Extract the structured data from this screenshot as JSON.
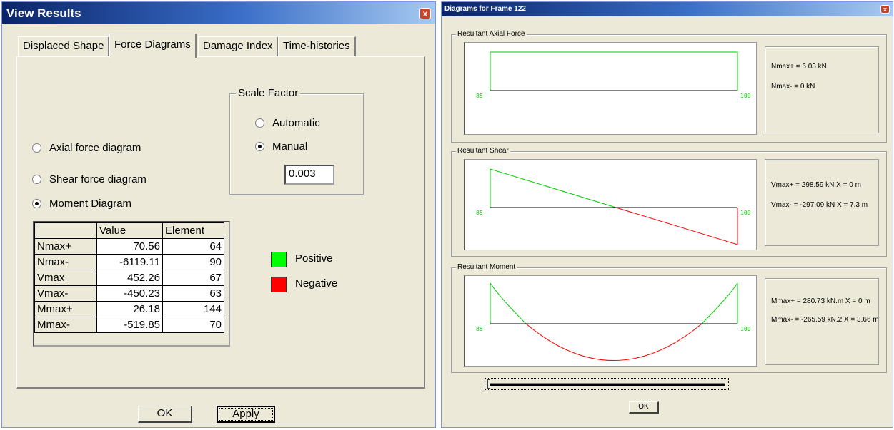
{
  "left_window": {
    "title": "View Results",
    "close_label": "x",
    "tabs": [
      {
        "label": "Displaced Shape"
      },
      {
        "label": "Force Diagrams"
      },
      {
        "label": "Damage Index"
      },
      {
        "label": "Time-histories"
      }
    ],
    "scale_factor": {
      "legend": "Scale Factor",
      "automatic_label": "Automatic",
      "manual_label": "Manual",
      "selected": "Manual",
      "value": "0.003"
    },
    "diagram_options": [
      {
        "label": "Axial force diagram",
        "checked": false
      },
      {
        "label": "Shear force diagram",
        "checked": false
      },
      {
        "label": "Moment Diagram",
        "checked": true
      }
    ],
    "results_table": {
      "headers": [
        "",
        "Value",
        "Element"
      ],
      "rows": [
        {
          "name": "Nmax+",
          "value": "70.56",
          "element": "64"
        },
        {
          "name": "Nmax-",
          "value": "-6119.11",
          "element": "90"
        },
        {
          "name": "Vmax",
          "value": "452.26",
          "element": "67"
        },
        {
          "name": "Vmax-",
          "value": "-450.23",
          "element": "63"
        },
        {
          "name": "Mmax+",
          "value": "26.18",
          "element": "144"
        },
        {
          "name": "Mmax-",
          "value": "-519.85",
          "element": "70"
        }
      ]
    },
    "legend": {
      "positive_label": "Positive",
      "negative_label": "Negative",
      "positive_color": "#00ff00",
      "negative_color": "#ff0000"
    },
    "ok_label": "OK",
    "apply_label": "Apply"
  },
  "right_window": {
    "title": "Diagrams for Frame 122",
    "close_label": "x",
    "axial": {
      "legend": "Resultant Axial Force",
      "start_node": "85",
      "end_node": "100",
      "max_pos": "Nmax+ = 6.03 kN",
      "max_neg": "Nmax- = 0 kN"
    },
    "shear": {
      "legend": "Resultant Shear",
      "start_node": "85",
      "end_node": "100",
      "max_pos": "Vmax+ = 298.59 kN X = 0 m",
      "max_neg": "Vmax- = -297.09 kN X = 7.3 m"
    },
    "moment": {
      "legend": "Resultant Moment",
      "start_node": "85",
      "end_node": "100",
      "max_pos": "Mmax+ = 280.73 kN.m X = 0 m",
      "max_neg": "Mmax- = -265.59 kN.2 X = 3.66 m"
    },
    "ok_label": "OK"
  }
}
